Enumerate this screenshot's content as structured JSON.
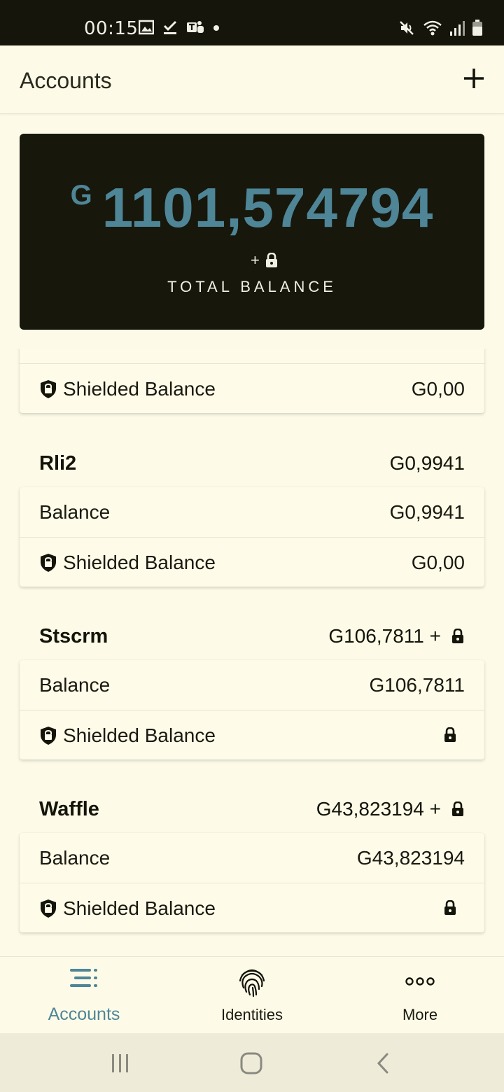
{
  "status_bar": {
    "time": "00:15"
  },
  "app_bar": {
    "title": "Accounts"
  },
  "total": {
    "currency": "G",
    "amount": "1101,574794",
    "plus": "+",
    "label": "TOTAL BALANCE"
  },
  "partial_account": {
    "shielded_label": "Shielded Balance",
    "shielded_value": "G0,00"
  },
  "accounts": [
    {
      "name": "Rli2",
      "total": "G0,9941",
      "balance_label": "Balance",
      "balance": "G0,9941",
      "shielded_label": "Shielded Balance",
      "shielded": "G0,00"
    },
    {
      "name": "Stscrm",
      "total": "G106,7811 +",
      "balance_label": "Balance",
      "balance": "G106,7811",
      "shielded_label": "Shielded Balance"
    },
    {
      "name": "Waffle",
      "total": "G43,823194 +",
      "balance_label": "Balance",
      "balance": "G43,823194",
      "shielded_label": "Shielded Balance"
    }
  ],
  "bottom_nav": {
    "accounts": "Accounts",
    "identities": "Identities",
    "more": "More"
  },
  "colors": {
    "accent": "#4e8597",
    "card_dark": "#17170b",
    "background": "#fdfbe8"
  }
}
